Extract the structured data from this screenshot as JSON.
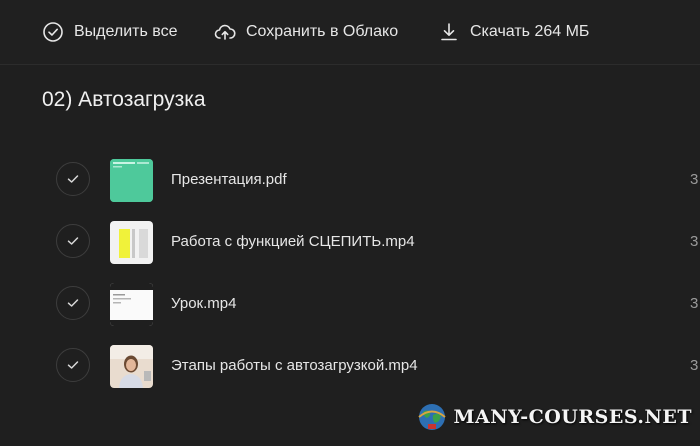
{
  "toolbar": {
    "select_all": "Выделить все",
    "save_cloud": "Сохранить в Облако",
    "download": "Скачать 264 МБ"
  },
  "folder": {
    "title": "02) Автозагрузка"
  },
  "files": [
    {
      "name": "Презентация.pdf",
      "size": "3"
    },
    {
      "name": "Работа с функцией СЦЕПИТЬ.mp4",
      "size": "3"
    },
    {
      "name": "Урок.mp4",
      "size": "3"
    },
    {
      "name": "Этапы работы с автозагрузкой.mp4",
      "size": "3"
    }
  ],
  "watermark": {
    "text": "MANY-COURSES.NET"
  }
}
